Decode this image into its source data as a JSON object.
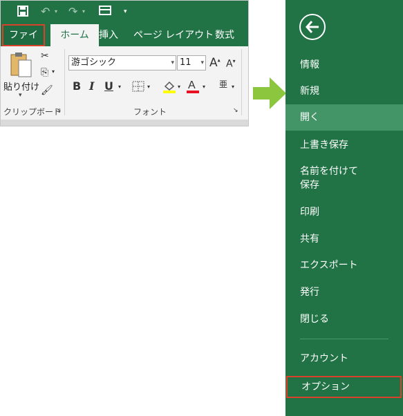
{
  "excel": {
    "tabs": [
      {
        "id": "file",
        "label": "ファイル"
      },
      {
        "id": "home",
        "label": "ホーム"
      },
      {
        "id": "insert",
        "label": "挿入"
      },
      {
        "id": "layout",
        "label": "ページ レイアウト"
      },
      {
        "id": "formula",
        "label": "数式"
      }
    ],
    "clipboard": {
      "paste_label": "貼り付け",
      "group_label": "クリップボード"
    },
    "font": {
      "name": "游ゴシック",
      "size": "11",
      "group_label": "フォント"
    }
  },
  "backstage": {
    "menu": [
      {
        "label": "情報"
      },
      {
        "label": "新規"
      },
      {
        "label": "開く"
      },
      {
        "label": "上書き保存"
      },
      {
        "label": "名前を付けて"
      },
      {
        "label": "保存"
      },
      {
        "label": "印刷"
      },
      {
        "label": "共有"
      },
      {
        "label": "エクスポート"
      },
      {
        "label": "発行"
      },
      {
        "label": "閉じる"
      },
      {
        "label": "アカウント"
      },
      {
        "label": "オプション"
      }
    ]
  },
  "colors": {
    "excel_green": "#217346",
    "highlight_red": "#d9412a",
    "active_item": "#439467",
    "arrow_green": "#8cc63f"
  },
  "icons": [
    "save-icon",
    "undo-icon",
    "redo-icon",
    "view-icon",
    "customize-icon",
    "paste-icon",
    "cut-icon",
    "copy-icon",
    "format-painter-icon",
    "bold-icon",
    "italic-icon",
    "underline-icon",
    "border-icon",
    "fill-color-icon",
    "font-color-icon",
    "phonetic-icon",
    "grow-font-icon",
    "shrink-font-icon",
    "back-arrow-icon",
    "right-arrow-icon"
  ]
}
